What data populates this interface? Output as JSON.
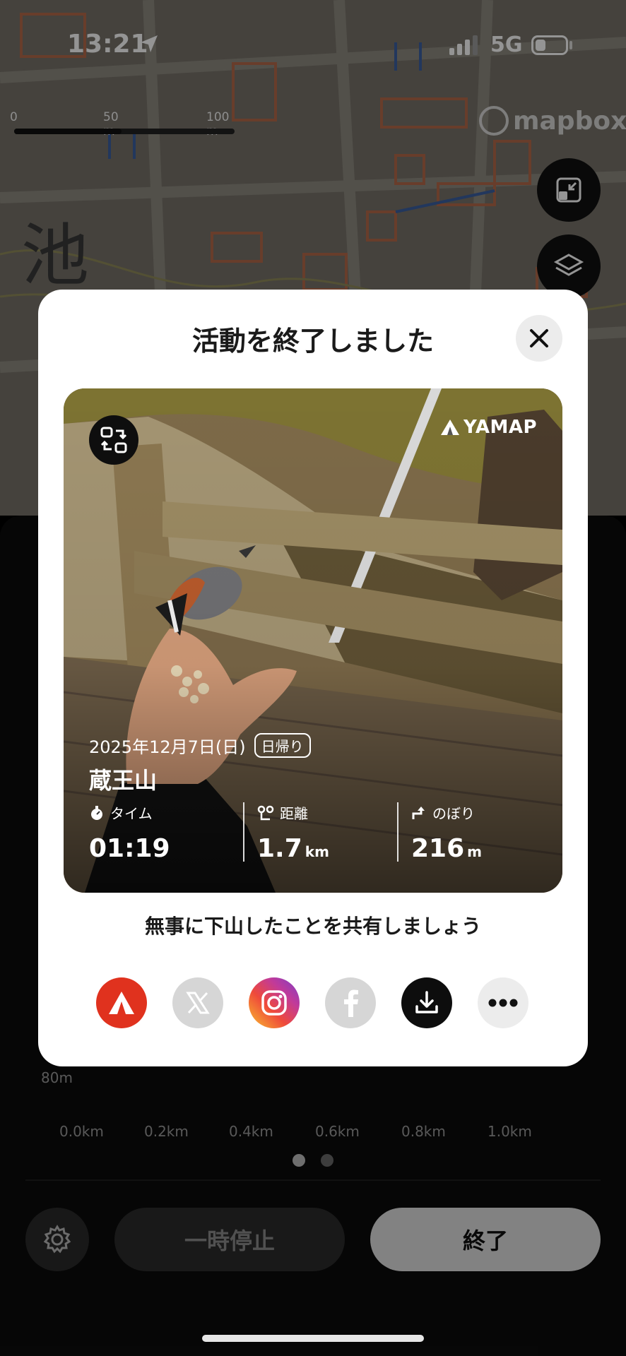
{
  "status_bar": {
    "time": "13:21",
    "network": "5G"
  },
  "map": {
    "scale_labels": [
      "0",
      "50 m",
      "100 m"
    ],
    "attribution": "mapbox",
    "kanji_label": "池"
  },
  "modal": {
    "title": "活動を終了しました",
    "card": {
      "brand": "YAMAP",
      "date": "2025年12月7日(日)",
      "trip_type": "日帰り",
      "mountain": "蔵王山",
      "stats": [
        {
          "label": "タイム",
          "value": "01:19",
          "unit": ""
        },
        {
          "label": "距離",
          "value": "1.7",
          "unit": "km"
        },
        {
          "label": "のぼり",
          "value": "216",
          "unit": "m"
        }
      ]
    },
    "share_message": "無事に下山したことを共有しましょう",
    "share_targets": [
      "yamap-icon",
      "x-icon",
      "instagram-icon",
      "facebook-icon",
      "download-icon",
      "more-icon"
    ]
  },
  "panel": {
    "y_tick": "80m",
    "x_ticks": [
      "0.0km",
      "0.2km",
      "0.4km",
      "0.6km",
      "0.8km",
      "1.0km"
    ],
    "pause_label": "一時停止",
    "end_label": "終了",
    "page_count": 2,
    "active_page": 1
  }
}
